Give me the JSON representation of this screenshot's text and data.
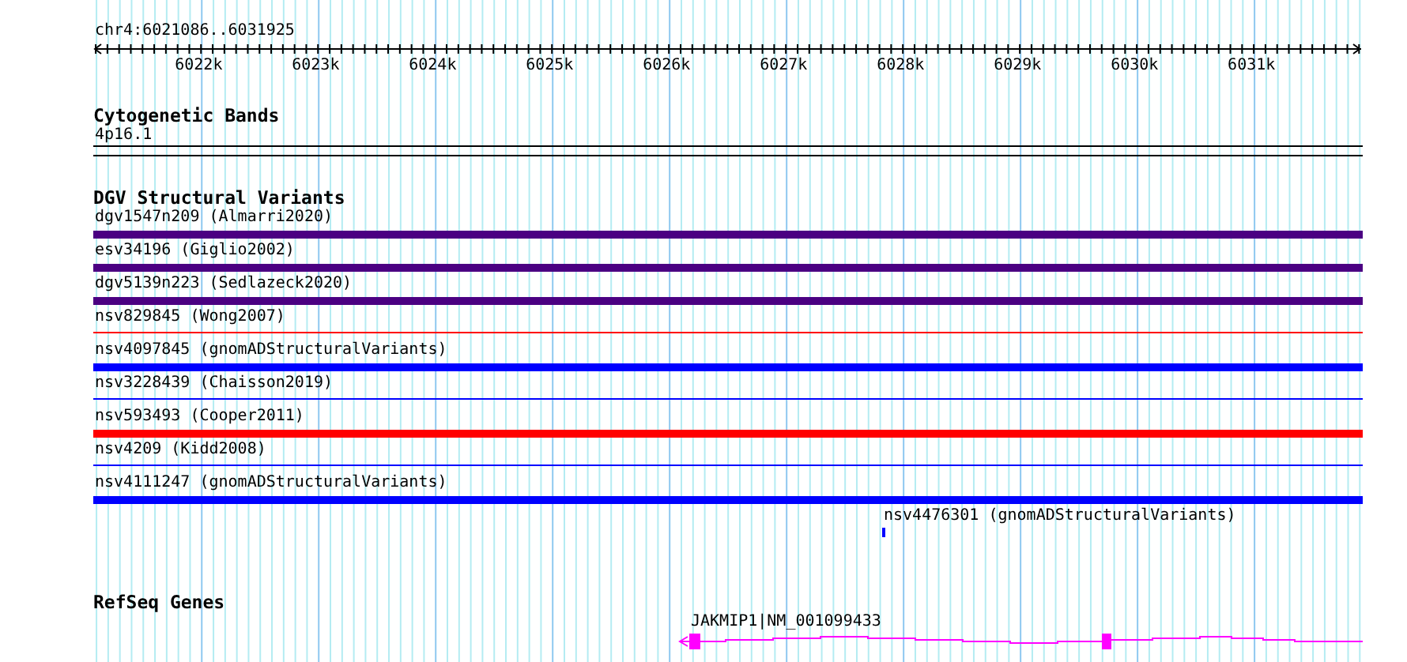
{
  "ruler": {
    "location": "chr4:6021086..6031925",
    "ticks": [
      "6022k",
      "6023k",
      "6024k",
      "6025k",
      "6026k",
      "6027k",
      "6028k",
      "6029k",
      "6030k",
      "6031k"
    ]
  },
  "cytobands": {
    "title": "Cytogenetic Bands",
    "band": "4p16.1"
  },
  "dgv": {
    "title": "DGV Structural Variants",
    "variants": [
      {
        "label": "dgv1547n209 (Almarri2020)",
        "kind": "thick",
        "color": "#4b0082"
      },
      {
        "label": "esv34196 (Giglio2002)",
        "kind": "thick",
        "color": "#4b0082"
      },
      {
        "label": "dgv5139n223 (Sedlazeck2020)",
        "kind": "thick",
        "color": "#4b0082"
      },
      {
        "label": "nsv829845 (Wong2007)",
        "kind": "thin",
        "color": "#ff0000"
      },
      {
        "label": "nsv4097845 (gnomADStructuralVariants)",
        "kind": "thick",
        "color": "#0000ff"
      },
      {
        "label": "nsv3228439 (Chaisson2019)",
        "kind": "thin",
        "color": "#0000ff"
      },
      {
        "label": "nsv593493 (Cooper2011)",
        "kind": "thick",
        "color": "#ff0000"
      },
      {
        "label": "nsv4209 (Kidd2008)",
        "kind": "thin",
        "color": "#0000ff"
      },
      {
        "label": "nsv4111247 (gnomADStructuralVariants)",
        "kind": "thick",
        "color": "#0000ff"
      },
      {
        "label": "nsv4476301 (gnomADStructuralVariants)",
        "kind": "mark",
        "color": "#0000ff"
      }
    ]
  },
  "refseq": {
    "title": "RefSeq Genes",
    "gene": "JAKMIP1|NM_001099433"
  }
}
